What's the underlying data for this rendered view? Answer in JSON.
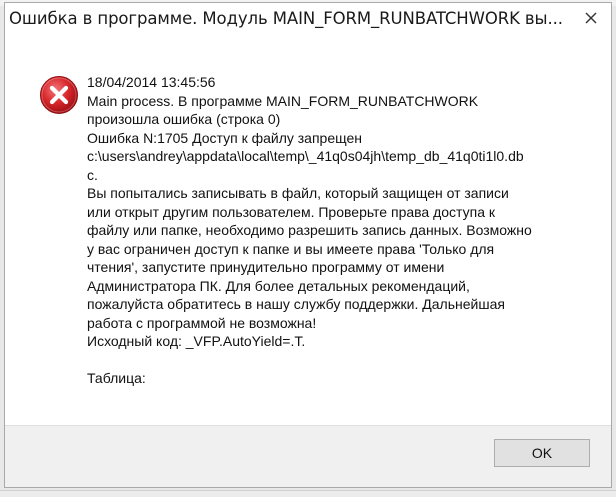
{
  "dialog": {
    "title": "Ошибка в программе. Модуль MAIN_FORM_RUNBATCHWORK вы...",
    "icon": "error-icon",
    "message_lines": [
      "18/04/2014 13:45:56",
      "Main process. В программе MAIN_FORM_RUNBATCHWORK",
      "произошла ошибка (строка 0)",
      "Ошибка N:1705 Доступ к файлу запрещен",
      "c:\\users\\andrey\\appdata\\local\\temp\\_41q0s04jh\\temp_db_41q0ti1l0.db",
      "c.",
      "Вы попытались записывать в файл, который защищен от записи",
      "или открыт другим пользователем. Проверьте права доступа к",
      "файлу или папке, необходимо разрешить запись данных. Возможно",
      "у вас ограничен доступ к папке и вы имеете права 'Только для",
      "чтения', запустите принудительно программу от имени",
      "Администратора ПК. Для более детальных рекомендаций,",
      "пожалуйста обратитесь в нашу службу поддержки. Дальнейшая",
      "работа с программой не возможна!",
      "Исходный код: _VFP.AutoYield=.T.",
      "",
      "Таблица:"
    ],
    "ok_label": "OK",
    "close_icon": "close-icon",
    "colors": {
      "error_red": "#d8282c",
      "footer_bg": "#f0f0f0",
      "button_bg": "#e1e1e1"
    }
  }
}
